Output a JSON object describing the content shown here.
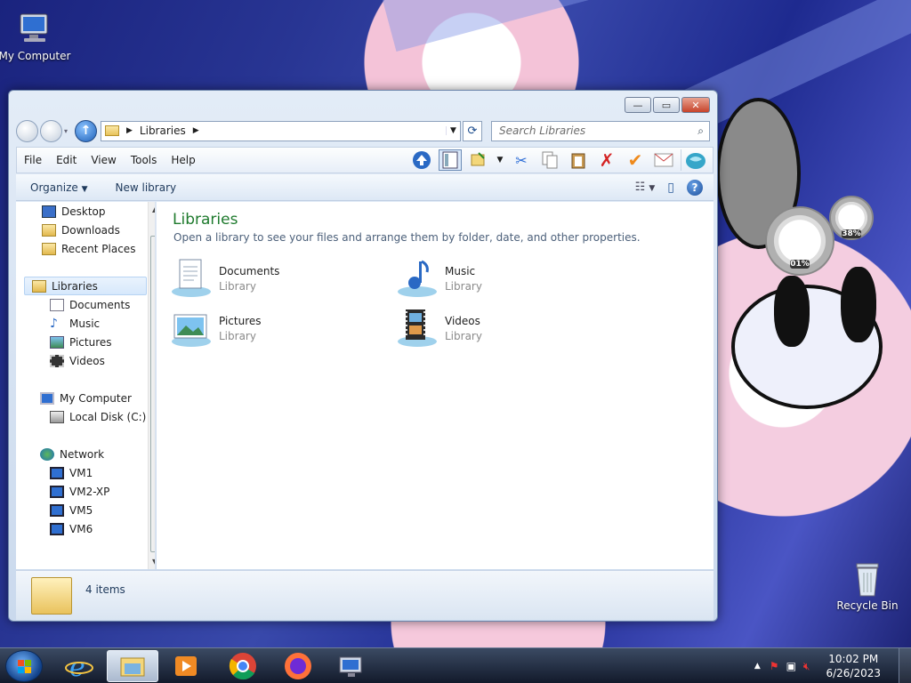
{
  "desktop": {
    "icons": [
      {
        "label": "My Computer"
      },
      {
        "label": "Recycle Bin"
      }
    ],
    "gadget": {
      "cpu": "01%",
      "memory": "38%"
    }
  },
  "window": {
    "address": {
      "crumb": "Libraries",
      "search_placeholder": "Search Libraries"
    },
    "menu": [
      "File",
      "Edit",
      "View",
      "Tools",
      "Help"
    ],
    "commands": {
      "organize": "Organize",
      "new_library": "New library"
    },
    "nav": {
      "favorites": [
        "Desktop",
        "Downloads",
        "Recent Places"
      ],
      "libraries": "Libraries",
      "library_items": [
        "Documents",
        "Music",
        "Pictures",
        "Videos"
      ],
      "computer": "My Computer",
      "drives": [
        "Local Disk (C:)"
      ],
      "network": "Network",
      "network_items": [
        "VM1",
        "VM2-XP",
        "VM5",
        "VM6"
      ]
    },
    "content": {
      "title": "Libraries",
      "subtitle": "Open a library to see your files and arrange them by folder, date, and other properties.",
      "items": [
        {
          "name": "Documents",
          "kind": "Library"
        },
        {
          "name": "Music",
          "kind": "Library"
        },
        {
          "name": "Pictures",
          "kind": "Library"
        },
        {
          "name": "Videos",
          "kind": "Library"
        }
      ]
    },
    "details": {
      "count": "4 items"
    }
  },
  "taskbar": {
    "time": "10:02 PM",
    "date": "6/26/2023"
  }
}
